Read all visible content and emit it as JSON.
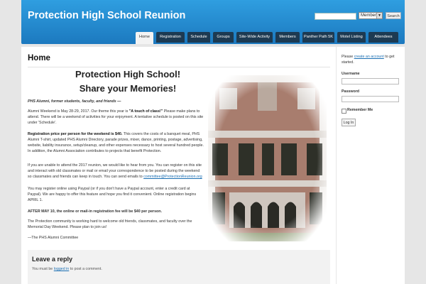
{
  "header": {
    "site_title": "Protection High School Reunion",
    "search": {
      "select_value": "Members",
      "button_label": "Search"
    }
  },
  "nav": {
    "items": [
      {
        "label": "Home",
        "active": true
      },
      {
        "label": "Registration"
      },
      {
        "label": "Schedule"
      },
      {
        "label": "Groups"
      },
      {
        "label": "Site-Wide Activity"
      },
      {
        "label": "Members"
      },
      {
        "label": "Panther Path 5K"
      },
      {
        "label": "Motel Listing"
      },
      {
        "label": "Attendees"
      }
    ]
  },
  "main": {
    "heading": "Home",
    "title_line1": "Protection High School!",
    "title_line2": "Share your Memories!",
    "greeting": "PHS Alumni, former students, faculty, and friends —",
    "p1_pre": "Alumni Weekend is May 28-29, 2017. Our theme this year is",
    "p1_theme": "\"A touch of class!\"",
    "p1_post": "Please make plans to attend. There will be a weekend of activities for your enjoyment. A tentative schedule is posted on this site under 'Schedule'.",
    "p2_bold": "Registration price per person for the weekend is $40.",
    "p2_rest": "This covers the costs of a banquet meal, PHS Alumni T-shirt, updated PHS Alumni Directory, parade prizes, mixer, dance, printing, postage, advertising, website, liability insurance, setup/cleanup, and other expenses necessary to host several hundred people. In addition, the Alumni Association contributes to projects that benefit Protection.",
    "p3_text": "If you are unable to attend the 2017 reunion, we would like to hear from you. You can register on this site and interact with old classmates or mail or email your correspondence to be posted during the weekend so classmates and friends can keep in touch. You can send emails to",
    "p3_email": "committee@ProtectionReunion.org",
    "p4": "You may register online using Paypal (or if you don't have a Paypal account, enter a credit card at Paypal). We are happy to offer this feature and hope you find it convenient. Online registration begins APRIL 1.",
    "p5": "AFTER MAY 10, the online or mail-in registration fee will be $40 per person.",
    "p6": "The Protection community is working hard to welcome old friends, classmates, and faculty over the Memorial Day Weekend. Please plan to join us!",
    "p7": "—The PHS Alumni Committee"
  },
  "reply": {
    "title": "Leave a reply",
    "text_pre": "You must be",
    "link": "logged in",
    "text_post": "to post a comment."
  },
  "sidebar": {
    "intro_pre": "Please",
    "intro_link": "create an account",
    "intro_post": "to get started.",
    "username_label": "Username",
    "password_label": "Password",
    "remember_label": "Remember Me",
    "login_button": "Log In"
  },
  "colors": {
    "header_top": "#2f9ee0",
    "header_bottom": "#1c79bf",
    "nav_tab": "#1d3a52",
    "link": "#1b6fb3"
  }
}
